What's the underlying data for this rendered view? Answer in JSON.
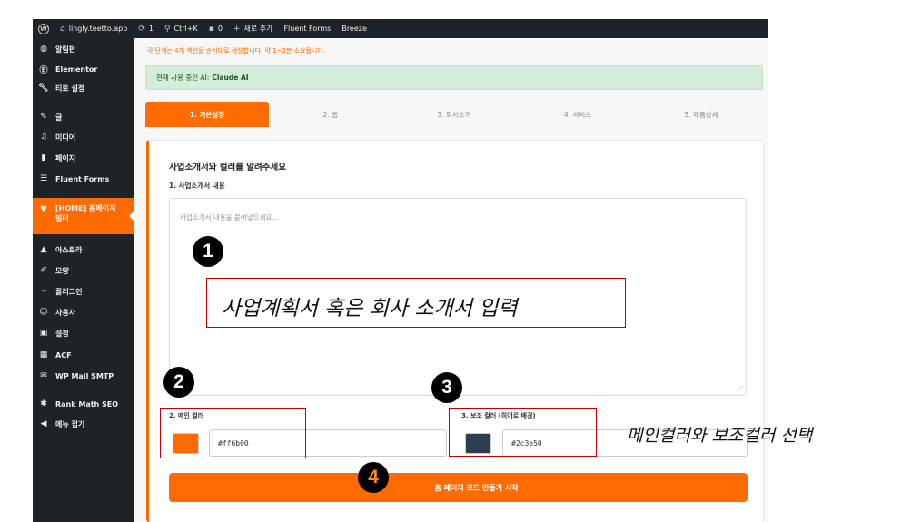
{
  "adminbar": {
    "site": "lingly.teetto.app",
    "updates": "1",
    "search_shortcut": "Ctrl+K",
    "comments": "0",
    "new_label": "새로 추가",
    "fluent": "Fluent Forms",
    "breeze": "Breeze"
  },
  "sidebar": {
    "items": [
      {
        "label": "알림판",
        "icon": "dashboard-icon"
      },
      {
        "label": "Elementor",
        "icon": "elementor-icon"
      },
      {
        "label": "티토 설정",
        "icon": "wrench-icon"
      },
      {
        "label": "글",
        "icon": "pin-icon"
      },
      {
        "label": "미디어",
        "icon": "media-icon"
      },
      {
        "label": "페이지",
        "icon": "page-icon"
      },
      {
        "label": "Fluent Forms",
        "icon": "form-icon"
      },
      {
        "label": "[HOME] 홈페이지 빌더",
        "icon": "heart-icon"
      },
      {
        "label": "아스트라",
        "icon": "astra-icon"
      },
      {
        "label": "모양",
        "icon": "brush-icon"
      },
      {
        "label": "플러그인",
        "icon": "plugin-icon"
      },
      {
        "label": "사용자",
        "icon": "users-icon"
      },
      {
        "label": "설정",
        "icon": "settings-icon"
      },
      {
        "label": "ACF",
        "icon": "acf-icon"
      },
      {
        "label": "WP Mail SMTP",
        "icon": "mail-icon"
      },
      {
        "label": "Rank Math SEO",
        "icon": "rankmath-icon"
      },
      {
        "label": "메뉴 접기",
        "icon": "collapse-icon"
      }
    ]
  },
  "main": {
    "notice": "각 단계는 4개 섹션을 순서대로 생성합니다. 약 1~2분 소요됩니다.",
    "ai_prefix": "현재 사용 중인 AI:",
    "ai_name": "Claude AI",
    "steps": [
      "1. 기본설정",
      "2. 홈",
      "3. 회사소개",
      "4. 서비스",
      "5. 제품상세"
    ],
    "card_title": "사업소개서와 컬러를 알려주세요",
    "content_label": "1. 사업소개서 내용",
    "content_placeholder": "사업소개서 내용을 붙여넣으세요...",
    "main_color_label": "2. 메인 컬러",
    "main_color_value": "#ff6b00",
    "sub_color_label": "3. 보조 컬러 (히어로 배경)",
    "sub_color_value": "#2c3e50",
    "start_button": "홈 페이지 코드 만들기 시작"
  },
  "annotations": {
    "badge1": "1",
    "badge2": "2",
    "badge3": "3",
    "badge4": "4",
    "text1": "사업계획서 혹은 회사 소개서 입력",
    "text2": "메인컬러와 보조컬러 선택"
  },
  "colors": {
    "accent": "#ff6b00",
    "admin_dark": "#1d2327",
    "success_bg": "#d4edda",
    "annotation_red": "#c00000"
  }
}
